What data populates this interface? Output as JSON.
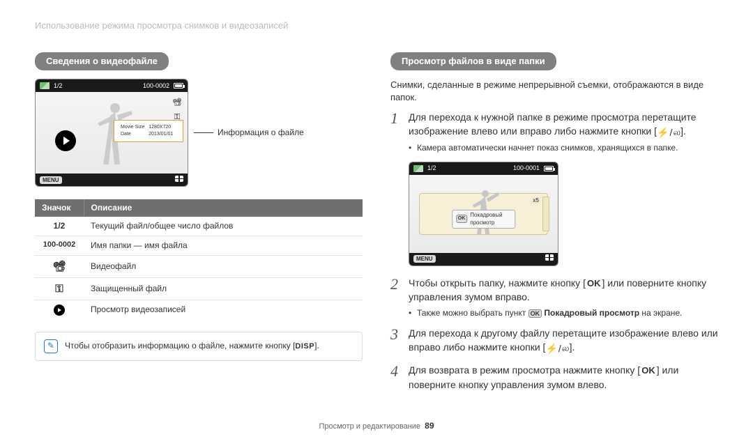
{
  "breadcrumb": "Использование режима просмотра снимков и видеозаписей",
  "left": {
    "heading": "Сведения о видеофайле",
    "screenshot": {
      "counter": "1/2",
      "folder_id": "100-0002",
      "menu": "MENU",
      "overlay": {
        "row1_label": "Movie Size",
        "row1_val": "1280X720",
        "row2_label": "Date",
        "row2_val": "2013/01/01"
      }
    },
    "caption": "Информация о файле",
    "table": {
      "h1": "Значок",
      "h2": "Описание",
      "rows": [
        {
          "icon": "1/2",
          "desc": "Текущий файл/общее число файлов"
        },
        {
          "icon": "100-0002",
          "desc": "Имя папки — имя файла"
        },
        {
          "icon": "cam",
          "desc": "Видеофайл"
        },
        {
          "icon": "key",
          "desc": "Защищенный файл"
        },
        {
          "icon": "play",
          "desc": "Просмотр видеозаписей"
        }
      ]
    },
    "note_pre": "Чтобы отобразить информацию о файле, нажмите кнопку [",
    "note_btn": "DISP",
    "note_post": "]."
  },
  "right": {
    "heading": "Просмотр файлов в виде папки",
    "intro": "Снимки, сделанные в режиме непрерывной съемки, отображаются в виде папок.",
    "step1": "Для перехода к нужной папке в режиме просмотра перетащите изображение влево или вправо либо нажмите кнопки [",
    "step1_post": "].",
    "step1_sub": "Камера автоматически начнет показ снимков, хранящихся в папке.",
    "scr2": {
      "counter": "1/2",
      "folder_id": "100-0001",
      "count": "x5",
      "menu": "MENU",
      "ok": "OK",
      "ok_label": "Покадровый просмотр"
    },
    "step2_a": "Чтобы открыть папку, нажмите кнопку [",
    "step2_b": "] или поверните кнопку управления зумом вправо.",
    "step2_sub_a": "Также можно выбрать пункт ",
    "step2_sub_ok": "OK",
    "step2_sub_b": " Покадровый просмотр",
    "step2_sub_c": " на экране.",
    "step3_a": "Для перехода к другому файлу перетащите изображение влево или вправо либо нажмите кнопки [",
    "step3_b": "].",
    "step4_a": "Для возврата в режим просмотра нажмите кнопку [",
    "step4_b": "] или поверните кнопку управления зумом влево.",
    "ok_kbd": "OK"
  },
  "footer": {
    "label": "Просмотр и редактирование",
    "page": "89"
  }
}
